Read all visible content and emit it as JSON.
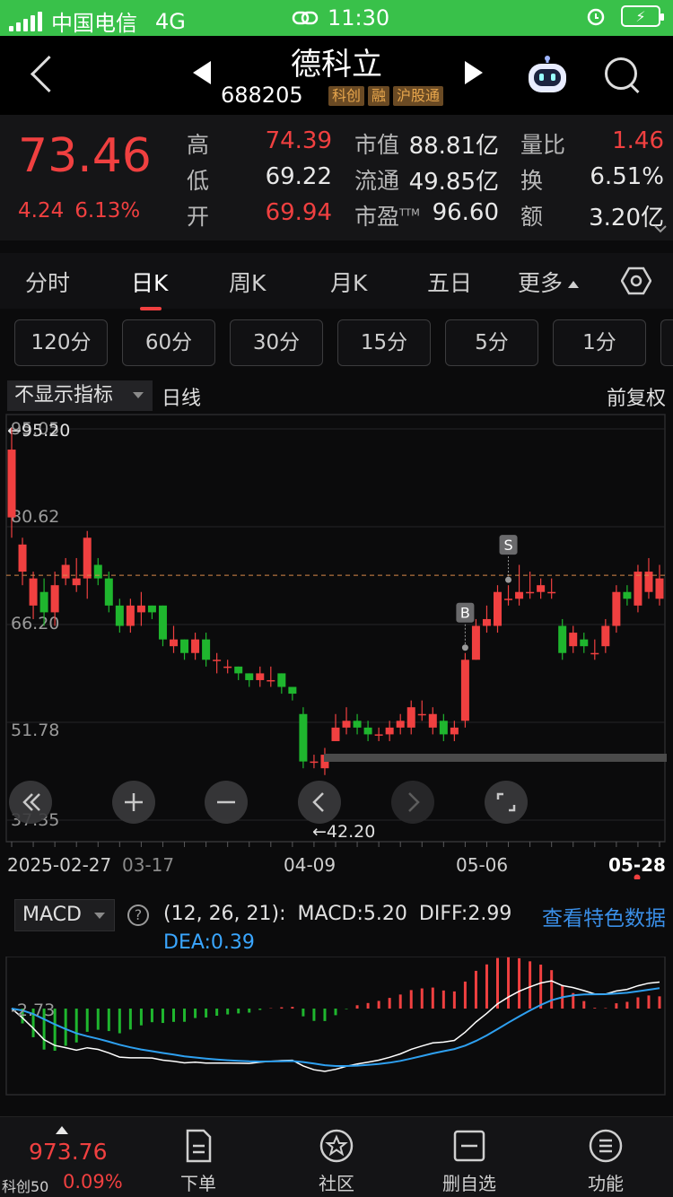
{
  "status": {
    "carrier": "中国电信",
    "network": "4G",
    "time": "11:30"
  },
  "header": {
    "name": "德科立",
    "code": "688205",
    "tags": [
      "科创",
      "融",
      "沪股通"
    ]
  },
  "quote": {
    "price": "73.46",
    "change": "4.24",
    "change_pct": "6.13%",
    "high_label": "高",
    "high": "74.39",
    "low_label": "低",
    "low": "69.22",
    "open_label": "开",
    "open": "69.94",
    "mcap_label": "市值",
    "mcap": "88.81亿",
    "float_label": "流通",
    "float": "49.85亿",
    "pe_label": "市盈",
    "pe_sup": "TTM",
    "pe": "96.60",
    "vr_label": "量比",
    "vr": "1.46",
    "turn_label": "换",
    "turn": "6.51%",
    "amt_label": "额",
    "amt": "3.20亿"
  },
  "tabs": [
    "分时",
    "日K",
    "周K",
    "月K",
    "五日",
    "更多"
  ],
  "periods": [
    "120分",
    "60分",
    "30分",
    "15分",
    "5分",
    "1分"
  ],
  "indicator": {
    "select": "不显示指标",
    "name": "日线",
    "adjust": "前复权"
  },
  "chart_data": {
    "type": "candlestick",
    "y_ticks": [
      "95.05",
      "80.62",
      "66.20",
      "51.78",
      "37.35"
    ],
    "max_label": "←95.20",
    "min_label": "←42.20",
    "x_ticks": [
      "2025-02-27",
      "03-17",
      "04-09",
      "05-06",
      "05-28"
    ],
    "current_price": 73.46,
    "ylim": [
      37.35,
      95.05
    ],
    "markers": [
      {
        "text": "B",
        "index": 42
      },
      {
        "text": "S",
        "index": 46
      }
    ],
    "candles": [
      [
        82,
        92,
        95.2,
        79
      ],
      [
        74,
        78,
        79,
        72
      ],
      [
        69,
        73,
        74,
        67
      ],
      [
        71,
        68,
        73,
        66
      ],
      [
        68,
        72,
        74,
        66
      ],
      [
        73,
        75,
        76,
        72
      ],
      [
        72,
        73,
        76,
        71
      ],
      [
        73,
        79,
        80,
        70
      ],
      [
        75,
        73,
        76,
        72
      ],
      [
        73,
        69,
        74,
        68
      ],
      [
        69,
        66,
        70,
        65
      ],
      [
        66,
        69,
        70,
        65
      ],
      [
        68,
        69,
        71,
        66
      ],
      [
        69,
        68,
        69,
        67
      ],
      [
        69,
        64,
        69,
        63
      ],
      [
        63,
        64,
        66,
        62
      ],
      [
        64,
        62,
        64,
        61
      ],
      [
        62,
        64,
        65,
        61
      ],
      [
        64,
        61,
        65,
        60
      ],
      [
        61,
        61,
        62,
        59
      ],
      [
        60,
        60,
        61,
        59
      ],
      [
        60,
        59,
        60,
        58
      ],
      [
        59,
        58,
        59,
        57
      ],
      [
        58,
        59,
        60,
        57
      ],
      [
        58,
        58,
        60,
        57
      ],
      [
        59,
        57,
        59,
        56
      ],
      [
        57,
        56,
        57,
        55
      ],
      [
        53,
        46,
        54,
        45
      ],
      [
        46,
        46,
        47,
        45
      ],
      [
        45,
        47,
        48,
        44
      ],
      [
        49,
        51,
        53,
        49
      ],
      [
        51,
        52,
        54,
        50
      ],
      [
        52,
        51,
        53,
        50
      ],
      [
        51,
        50,
        52,
        49
      ],
      [
        50,
        50,
        51,
        49
      ],
      [
        50,
        51,
        52,
        49
      ],
      [
        51,
        52,
        53,
        50
      ],
      [
        51,
        54,
        55,
        50
      ],
      [
        53,
        53,
        55,
        52
      ],
      [
        51,
        53,
        54,
        50
      ],
      [
        52,
        50,
        53,
        49
      ],
      [
        50,
        51,
        52,
        49
      ],
      [
        52,
        61,
        62,
        51
      ],
      [
        61,
        66,
        67,
        61
      ],
      [
        66,
        67,
        69,
        65
      ],
      [
        66,
        71,
        72,
        65
      ],
      [
        70,
        70,
        72,
        69
      ],
      [
        70,
        71,
        75,
        69
      ],
      [
        71,
        71,
        74,
        70
      ],
      [
        71,
        72,
        73,
        70
      ],
      [
        71,
        71,
        73,
        70
      ],
      [
        66,
        62,
        67,
        61
      ],
      [
        63,
        65,
        66,
        62
      ],
      [
        64,
        63,
        65,
        62
      ],
      [
        62,
        62,
        64,
        61
      ],
      [
        63,
        66,
        67,
        62
      ],
      [
        66,
        71,
        72,
        65
      ],
      [
        71,
        70,
        72,
        69
      ],
      [
        69,
        74,
        75,
        68
      ],
      [
        71,
        74,
        76,
        70
      ],
      [
        70,
        73,
        75,
        69
      ]
    ]
  },
  "macd": {
    "name": "MACD",
    "help": "?",
    "params": "(12, 26, 21):",
    "macd_label": "MACD:5.20",
    "diff_label": "DIFF:2.99",
    "dea_label": "DEA:0.39",
    "link": "查看特色数据",
    "zero_label": "-2.73"
  },
  "bottom": {
    "index_value": "973.76",
    "index_name": "科创50",
    "index_pct": "0.09%",
    "items": [
      "下单",
      "社区",
      "删自选",
      "功能"
    ]
  },
  "colors": {
    "up": "#f04040",
    "down": "#1fb62e",
    "diff": "#ffffff",
    "dea": "#2ea0f0"
  }
}
